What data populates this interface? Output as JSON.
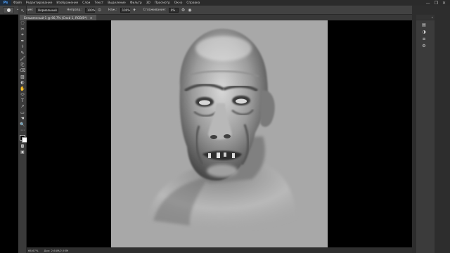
{
  "app": {
    "logo": "Ps"
  },
  "menu": [
    "Файл",
    "Редактирование",
    "Изображение",
    "Слои",
    "Текст",
    "Выделение",
    "Фильтр",
    "3D",
    "Просмотр",
    "Окно",
    "Справка"
  ],
  "window_controls": {
    "minimize": "—",
    "maximize": "❐",
    "close": "✕"
  },
  "options": {
    "brush_size": "•",
    "mode_label": "Режим:",
    "mode_value": "Нормальный",
    "opacity_label": "Непрозр.:",
    "opacity_value": "100%",
    "flow_label": "Наж.:",
    "flow_value": "100%",
    "smoothing_label": "Сглаживание:",
    "smoothing_value": "0%"
  },
  "tab": {
    "title": "Безымянный-1 @ 66,7% (Слой 1, RGB/8*)",
    "close": "✕"
  },
  "tools": [
    "↖",
    "⬚",
    "◌",
    "✂",
    "⌗",
    "✒",
    "⚕",
    "✎",
    "🖌",
    "⎘",
    "⌫",
    "▨",
    "◐",
    "✋",
    "⬭",
    "T",
    "↗",
    "▭",
    "☚",
    "🔍",
    "⋯"
  ],
  "status": {
    "zoom": "66,67%",
    "doc": "Док: 2,64M/2,93M"
  },
  "right_panel": {
    "collapse": "«",
    "icons": [
      "▤",
      "◑",
      "≡",
      "⚙"
    ]
  },
  "colors": {
    "menubar": "#2b2b2b",
    "options": "#424242",
    "canvas_bg": "#a8a8a8",
    "workspace": "#000000"
  }
}
